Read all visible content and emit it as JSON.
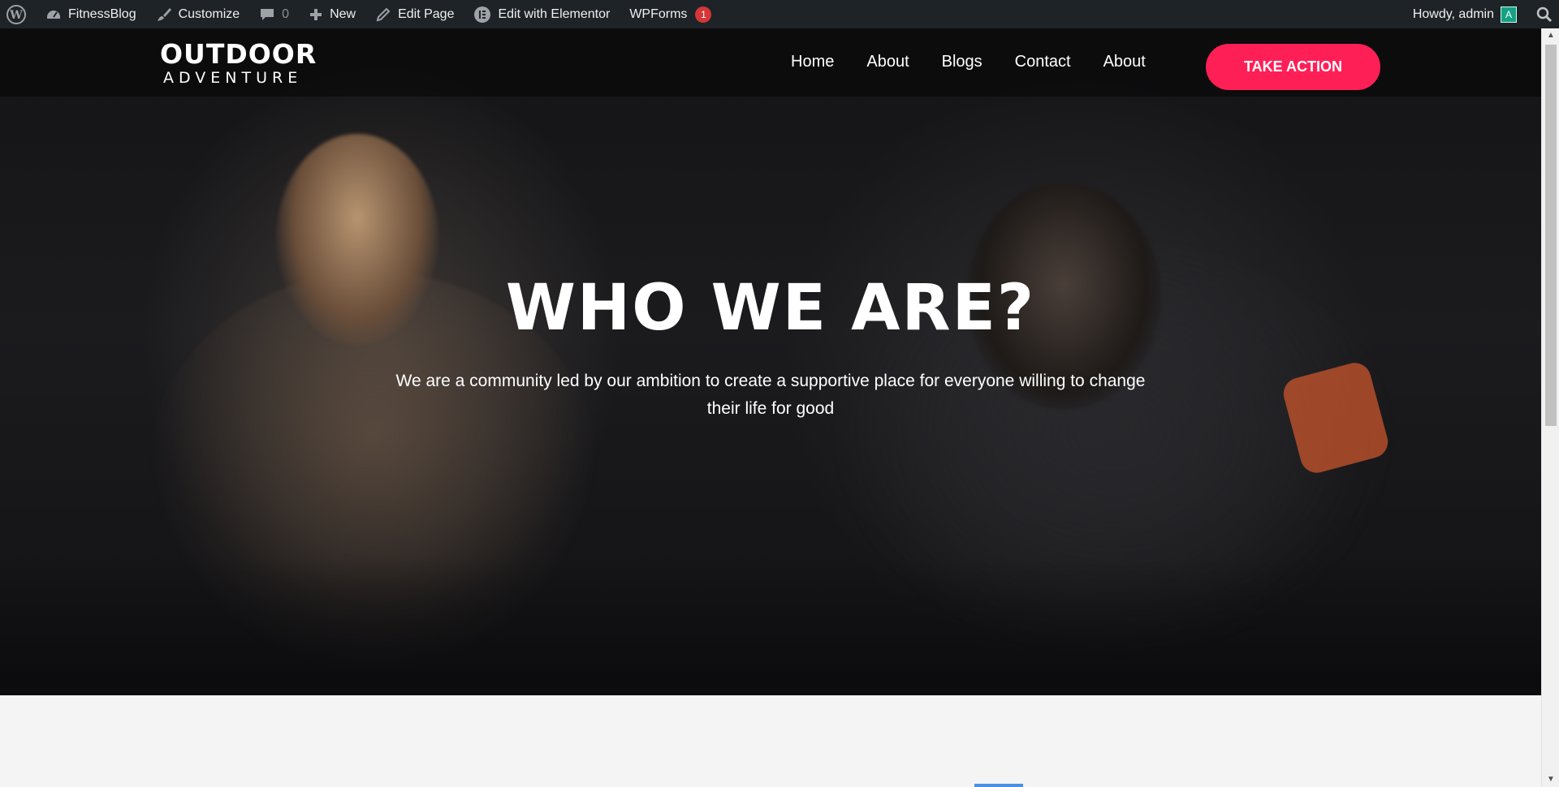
{
  "adminbar": {
    "site_name": "FitnessBlog",
    "customize": "Customize",
    "comments_count": "0",
    "new": "New",
    "edit_page": "Edit Page",
    "edit_elementor": "Edit with Elementor",
    "wpforms": "WPForms",
    "wpforms_badge": "1",
    "howdy": "Howdy, admin",
    "avatar_letter": "A"
  },
  "header": {
    "logo_line1": "OUTDOOR",
    "logo_line2": "ADVENTURE",
    "nav": [
      "Home",
      "About",
      "Blogs",
      "Contact",
      "About"
    ],
    "cta": "TAKE ACTION"
  },
  "hero": {
    "title": "WHO WE ARE?",
    "subtitle": "We are a community led by our ambition to create a supportive place for everyone willing to change their life for good"
  },
  "colors": {
    "accent": "#ff1f57",
    "adminbar_bg": "#1d2327",
    "badge": "#d63638"
  }
}
